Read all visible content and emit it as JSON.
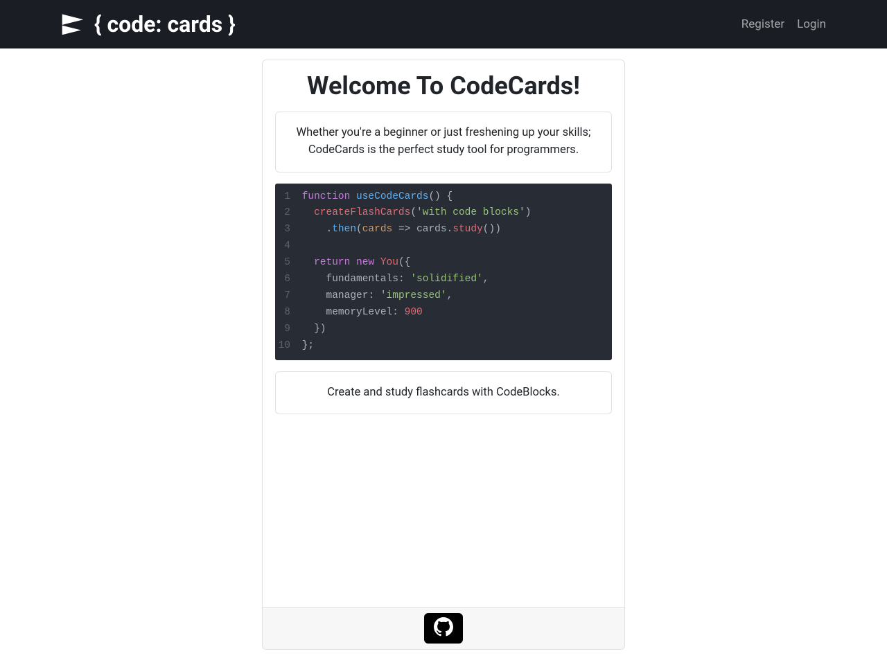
{
  "nav": {
    "brand": "{ code: cards }",
    "links": {
      "register": "Register",
      "login": "Login"
    }
  },
  "hero": {
    "title": "Welcome To CodeCards!",
    "desc_l1": "Whether you're a beginner or just freshening up your skills;",
    "desc_l2": "CodeCards is the perfect study tool for programmers.",
    "tagline": "Create and study flashcards with CodeBlocks."
  },
  "code": {
    "l1": {
      "kw": "function",
      "fn": "useCodeCards",
      "tail": "() {"
    },
    "l2": {
      "fn": "createFlashCards",
      "p1": "(",
      "str": "'with code blocks'",
      "p2": ")"
    },
    "l3": {
      "a": ".",
      "then": "then",
      "b": "(",
      "cards": "cards",
      "c": " => ",
      "cards2": "cards",
      "d": ".",
      "study": "study",
      "e": "())"
    },
    "l5": {
      "ret": "return",
      "neew": "new",
      "cls": "You",
      "tail": "({"
    },
    "l6": {
      "prop": "fundamentals",
      "p": ": ",
      "str": "'solidified'",
      "c": ","
    },
    "l7": {
      "prop": "manager",
      "p": ": ",
      "str": "'impressed'",
      "c": ","
    },
    "l8": {
      "prop": "memoryLevel",
      "p": ": ",
      "num": "900"
    },
    "l9": "  })",
    "l10": "};",
    "ln": {
      "1": "1",
      "2": "2",
      "3": "3",
      "4": "4",
      "5": "5",
      "6": "6",
      "7": "7",
      "8": "8",
      "9": "9",
      "10": "10"
    }
  }
}
